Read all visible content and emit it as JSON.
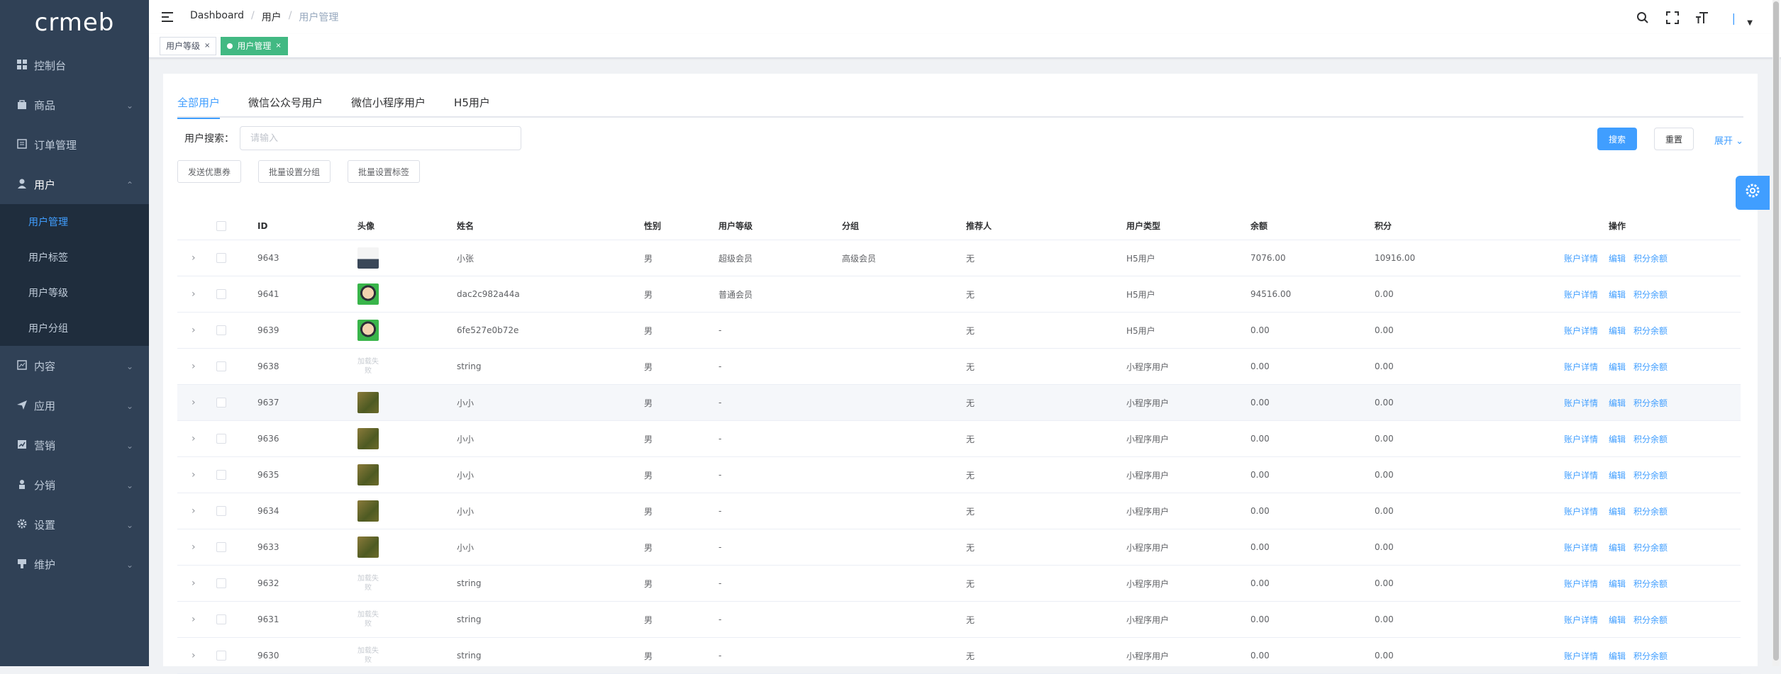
{
  "brand": {
    "logo": "crmeb"
  },
  "sidebar": {
    "items": [
      {
        "label": "控制台"
      },
      {
        "label": "商品"
      },
      {
        "label": "订单管理"
      },
      {
        "label": "用户"
      },
      {
        "label": "内容"
      },
      {
        "label": "应用"
      },
      {
        "label": "营销"
      },
      {
        "label": "分销"
      },
      {
        "label": "设置"
      },
      {
        "label": "维护"
      }
    ],
    "user_submenu": [
      {
        "label": "用户管理"
      },
      {
        "label": "用户标签"
      },
      {
        "label": "用户等级"
      },
      {
        "label": "用户分组"
      }
    ]
  },
  "header": {
    "breadcrumb": [
      "Dashboard",
      "用户",
      "用户管理"
    ],
    "separator": "/",
    "avatar_char": "|"
  },
  "tags": [
    {
      "label": "用户等级"
    },
    {
      "label": "用户管理"
    }
  ],
  "tabs": [
    "全部用户",
    "微信公众号用户",
    "微信小程序用户",
    "H5用户"
  ],
  "search": {
    "label": "用户搜索：",
    "placeholder": "请输入",
    "search_btn": "搜索",
    "reset_btn": "重置",
    "expand": "展开"
  },
  "actions": [
    "发送优惠券",
    "批量设置分组",
    "批量设置标签"
  ],
  "table": {
    "headers": [
      "ID",
      "头像",
      "姓名",
      "性别",
      "用户等级",
      "分组",
      "推荐人",
      "用户类型",
      "余额",
      "积分",
      "操作"
    ],
    "ops": [
      "账户详情",
      "编辑",
      "积分余额"
    ],
    "rows": [
      {
        "id": "9643",
        "avatar": "car",
        "name": "小张",
        "sex": "男",
        "level": "超级会员",
        "group": "高级会员",
        "ref": "无",
        "type": "H5用户",
        "balance": "7076.00",
        "points": "10916.00"
      },
      {
        "id": "9641",
        "avatar": "face",
        "name": "dac2c982a44a",
        "sex": "男",
        "level": "普通会员",
        "group": "",
        "ref": "无",
        "type": "H5用户",
        "balance": "94516.00",
        "points": "0.00"
      },
      {
        "id": "9639",
        "avatar": "face",
        "name": "6fe527e0b72e",
        "sex": "男",
        "level": "-",
        "group": "",
        "ref": "无",
        "type": "H5用户",
        "balance": "0.00",
        "points": "0.00"
      },
      {
        "id": "9638",
        "avatar": "txt",
        "name": "string",
        "sex": "男",
        "level": "-",
        "group": "",
        "ref": "无",
        "type": "小程序用户",
        "balance": "0.00",
        "points": "0.00"
      },
      {
        "id": "9637",
        "avatar": "field",
        "name": "小小",
        "sex": "男",
        "level": "-",
        "group": "",
        "ref": "无",
        "type": "小程序用户",
        "balance": "0.00",
        "points": "0.00"
      },
      {
        "id": "9636",
        "avatar": "field",
        "name": "小小",
        "sex": "男",
        "level": "-",
        "group": "",
        "ref": "无",
        "type": "小程序用户",
        "balance": "0.00",
        "points": "0.00"
      },
      {
        "id": "9635",
        "avatar": "field",
        "name": "小小",
        "sex": "男",
        "level": "-",
        "group": "",
        "ref": "无",
        "type": "小程序用户",
        "balance": "0.00",
        "points": "0.00"
      },
      {
        "id": "9634",
        "avatar": "field",
        "name": "小小",
        "sex": "男",
        "level": "-",
        "group": "",
        "ref": "无",
        "type": "小程序用户",
        "balance": "0.00",
        "points": "0.00"
      },
      {
        "id": "9633",
        "avatar": "field",
        "name": "小小",
        "sex": "男",
        "level": "-",
        "group": "",
        "ref": "无",
        "type": "小程序用户",
        "balance": "0.00",
        "points": "0.00"
      },
      {
        "id": "9632",
        "avatar": "txt",
        "name": "string",
        "sex": "男",
        "level": "-",
        "group": "",
        "ref": "无",
        "type": "小程序用户",
        "balance": "0.00",
        "points": "0.00"
      },
      {
        "id": "9631",
        "avatar": "txt",
        "name": "string",
        "sex": "男",
        "level": "-",
        "group": "",
        "ref": "无",
        "type": "小程序用户",
        "balance": "0.00",
        "points": "0.00"
      },
      {
        "id": "9630",
        "avatar": "txt",
        "name": "string",
        "sex": "男",
        "level": "-",
        "group": "",
        "ref": "无",
        "type": "小程序用户",
        "balance": "0.00",
        "points": "0.00"
      }
    ],
    "avatar_text": "加载失败"
  }
}
